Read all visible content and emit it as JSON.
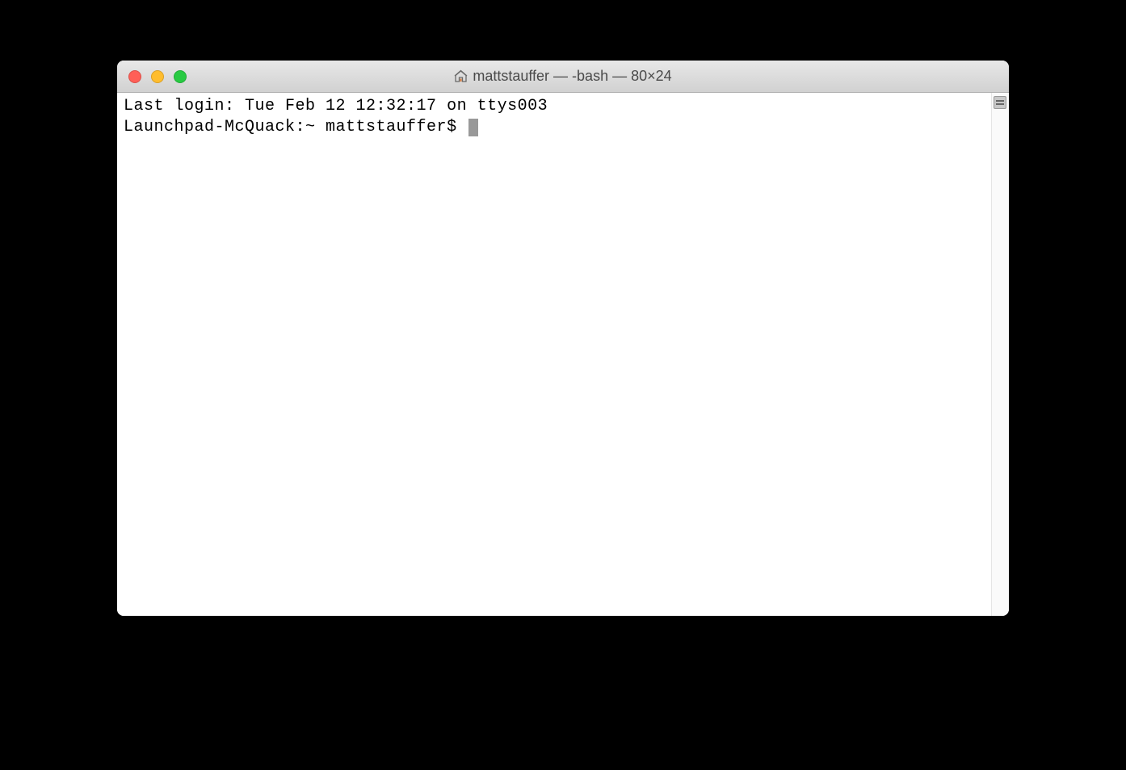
{
  "window": {
    "title": "mattstauffer — -bash — 80×24"
  },
  "terminal": {
    "last_login": "Last login: Tue Feb 12 12:32:17 on ttys003",
    "prompt": "Launchpad-McQuack:~ mattstauffer$ "
  }
}
